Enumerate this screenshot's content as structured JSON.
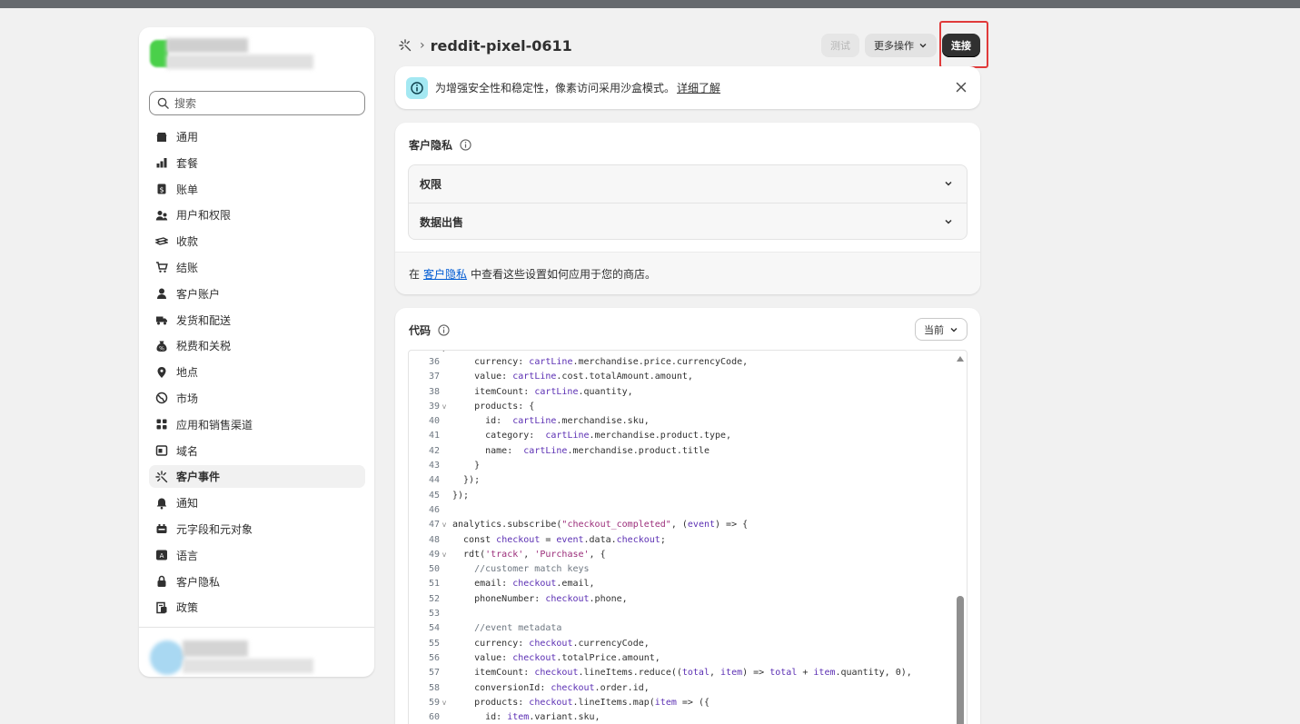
{
  "sidebar": {
    "search_placeholder": "搜索",
    "items": [
      {
        "label": "通用",
        "icon": "store-icon"
      },
      {
        "label": "套餐",
        "icon": "plan-icon"
      },
      {
        "label": "账单",
        "icon": "billing-icon"
      },
      {
        "label": "用户和权限",
        "icon": "users-icon"
      },
      {
        "label": "收款",
        "icon": "payments-icon"
      },
      {
        "label": "结账",
        "icon": "cart-icon"
      },
      {
        "label": "客户账户",
        "icon": "person-icon"
      },
      {
        "label": "发货和配送",
        "icon": "truck-icon"
      },
      {
        "label": "税费和关税",
        "icon": "tax-icon"
      },
      {
        "label": "地点",
        "icon": "location-icon"
      },
      {
        "label": "市场",
        "icon": "globe-icon"
      },
      {
        "label": "应用和销售渠道",
        "icon": "apps-icon"
      },
      {
        "label": "域名",
        "icon": "domain-icon"
      },
      {
        "label": "客户事件",
        "icon": "events-icon",
        "active": true
      },
      {
        "label": "通知",
        "icon": "bell-icon"
      },
      {
        "label": "元字段和元对象",
        "icon": "metafields-icon"
      },
      {
        "label": "语言",
        "icon": "language-icon"
      },
      {
        "label": "客户隐私",
        "icon": "lock-icon"
      },
      {
        "label": "政策",
        "icon": "policy-icon"
      }
    ]
  },
  "header": {
    "title": "reddit-pixel-0611",
    "test_label": "测试",
    "more_label": "更多操作",
    "connect_label": "连接"
  },
  "banner": {
    "message": "为增强安全性和稳定性，像素访问采用沙盒模式。",
    "link": "详细了解"
  },
  "privacy": {
    "title": "客户隐私",
    "rows": [
      "权限",
      "数据出售"
    ],
    "footer_prefix": "在",
    "footer_link": "客户隐私",
    "footer_suffix": "中查看这些设置如何应用于您的商店。"
  },
  "code": {
    "title": "代码",
    "version": "当前",
    "lines": [
      {
        "n": "36",
        "fold": "",
        "text": "    currency: cartLine.merchandise.price.currencyCode,"
      },
      {
        "n": "37",
        "fold": "",
        "text": "    value: cartLine.cost.totalAmount.amount,"
      },
      {
        "n": "38",
        "fold": "",
        "text": "    itemCount: cartLine.quantity,"
      },
      {
        "n": "39",
        "fold": "v",
        "text": "    products: {"
      },
      {
        "n": "40",
        "fold": "",
        "text": "      id:  cartLine.merchandise.sku,"
      },
      {
        "n": "41",
        "fold": "",
        "text": "      category:  cartLine.merchandise.product.type,"
      },
      {
        "n": "42",
        "fold": "",
        "text": "      name:  cartLine.merchandise.product.title"
      },
      {
        "n": "43",
        "fold": "",
        "text": "    }"
      },
      {
        "n": "44",
        "fold": "",
        "text": "  });"
      },
      {
        "n": "45",
        "fold": "",
        "text": "});"
      },
      {
        "n": "46",
        "fold": "",
        "text": ""
      },
      {
        "n": "47",
        "fold": "v",
        "text": "analytics.subscribe(\"checkout_completed\", (event) => {"
      },
      {
        "n": "48",
        "fold": "",
        "text": "  const checkout = event.data.checkout;"
      },
      {
        "n": "49",
        "fold": "v",
        "text": "  rdt('track', 'Purchase', {"
      },
      {
        "n": "50",
        "fold": "",
        "text": "    //customer match keys"
      },
      {
        "n": "51",
        "fold": "",
        "text": "    email: checkout.email,"
      },
      {
        "n": "52",
        "fold": "",
        "text": "    phoneNumber: checkout.phone,"
      },
      {
        "n": "53",
        "fold": "",
        "text": ""
      },
      {
        "n": "54",
        "fold": "",
        "text": "    //event metadata"
      },
      {
        "n": "55",
        "fold": "",
        "text": "    currency: checkout.currencyCode,"
      },
      {
        "n": "56",
        "fold": "",
        "text": "    value: checkout.totalPrice.amount,"
      },
      {
        "n": "57",
        "fold": "",
        "text": "    itemCount: checkout.lineItems.reduce((total, item) => total + item.quantity, 0),"
      },
      {
        "n": "58",
        "fold": "",
        "text": "    conversionId: checkout.order.id,"
      },
      {
        "n": "59",
        "fold": "v",
        "text": "    products: checkout.lineItems.map(item => ({"
      },
      {
        "n": "60",
        "fold": "",
        "text": "      id: item.variant.sku,"
      }
    ]
  },
  "colors": {
    "primary_button": "#303030",
    "highlight": "#e03a3a",
    "info_badge": "#a4e8f2",
    "link": "#005bd3"
  }
}
